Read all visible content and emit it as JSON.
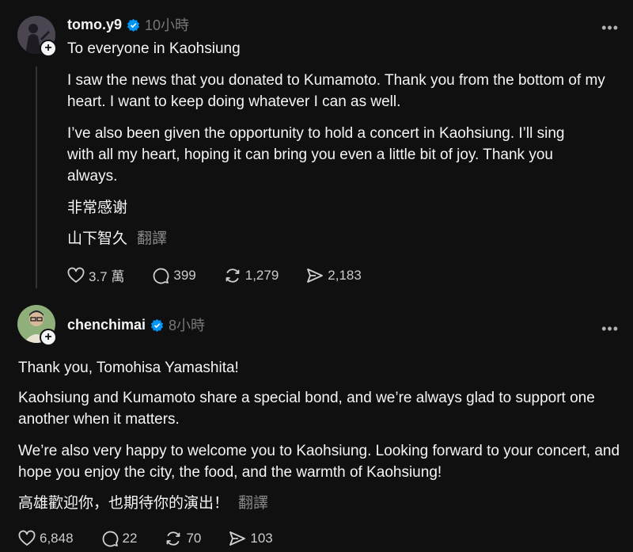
{
  "post1": {
    "username": "tomo.y9",
    "time": "10小時",
    "title": "To everyone in Kaohsiung",
    "paragraphs": [
      "I saw the news that you donated to Kumamoto. Thank you from the bottom of my heart. I want to keep doing whatever I can as well.",
      "I’ve also been given the opportunity to hold a concert in Kaohsiung. I’ll sing with all my heart, hoping it can bring you even a little bit of joy. Thank you always.",
      "非常感谢",
      "山下智久"
    ],
    "translate_label": "翻譯",
    "stats": {
      "likes": "3.7 萬",
      "replies": "399",
      "reposts": "1,279",
      "shares": "2,183"
    }
  },
  "post2": {
    "username": "chenchimai",
    "time": "8小時",
    "paragraphs": [
      "Thank you, Tomohisa Yamashita!",
      "Kaohsiung and Kumamoto share a special bond, and we’re always glad to support one another when it matters.",
      "We’re also very happy to welcome you to Kaohsiung. Looking forward to your concert, and hope you enjoy the city, the food, and the warmth of Kaohsiung!",
      "高雄歡迎你，也期待你的演出！"
    ],
    "translate_label": "翻譯",
    "stats": {
      "likes": "6,848",
      "replies": "22",
      "reposts": "70",
      "shares": "103"
    }
  },
  "colors": {
    "background": "#101010",
    "text": "#f3f5f7",
    "muted": "#777777",
    "verified": "#0095f6"
  },
  "icons": [
    "plus-icon",
    "verified-badge-icon",
    "more-icon",
    "heart-icon",
    "comment-icon",
    "repost-icon",
    "share-icon"
  ]
}
